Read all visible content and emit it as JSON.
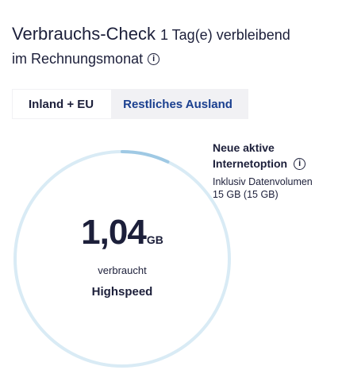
{
  "header": {
    "title": "Verbrauchs-Check",
    "days_left": "1 Tag(e) verbleibend",
    "period": "im Rechnungsmonat",
    "info_icon": "info-circle-icon"
  },
  "tabs": [
    {
      "label": "Inland + EU",
      "active": true
    },
    {
      "label": "Restliches Ausland",
      "active": false
    }
  ],
  "usage": {
    "value": "1,04",
    "unit": "GB",
    "used_label": "verbraucht",
    "speed_label": "Highspeed",
    "progress_fraction": 0.07,
    "ring_color": "#d9ebf5"
  },
  "option": {
    "title_line1": "Neue aktive",
    "title_line2": "Internetoption",
    "info_icon": "info-circle-icon",
    "volume_label": "Inklusiv Datenvolumen",
    "volume_value": "15 GB (15 GB)"
  },
  "colors": {
    "text": "#1c1f3a",
    "tab_link": "#1a3f8f",
    "tab_bar": "#f1f1f4"
  }
}
